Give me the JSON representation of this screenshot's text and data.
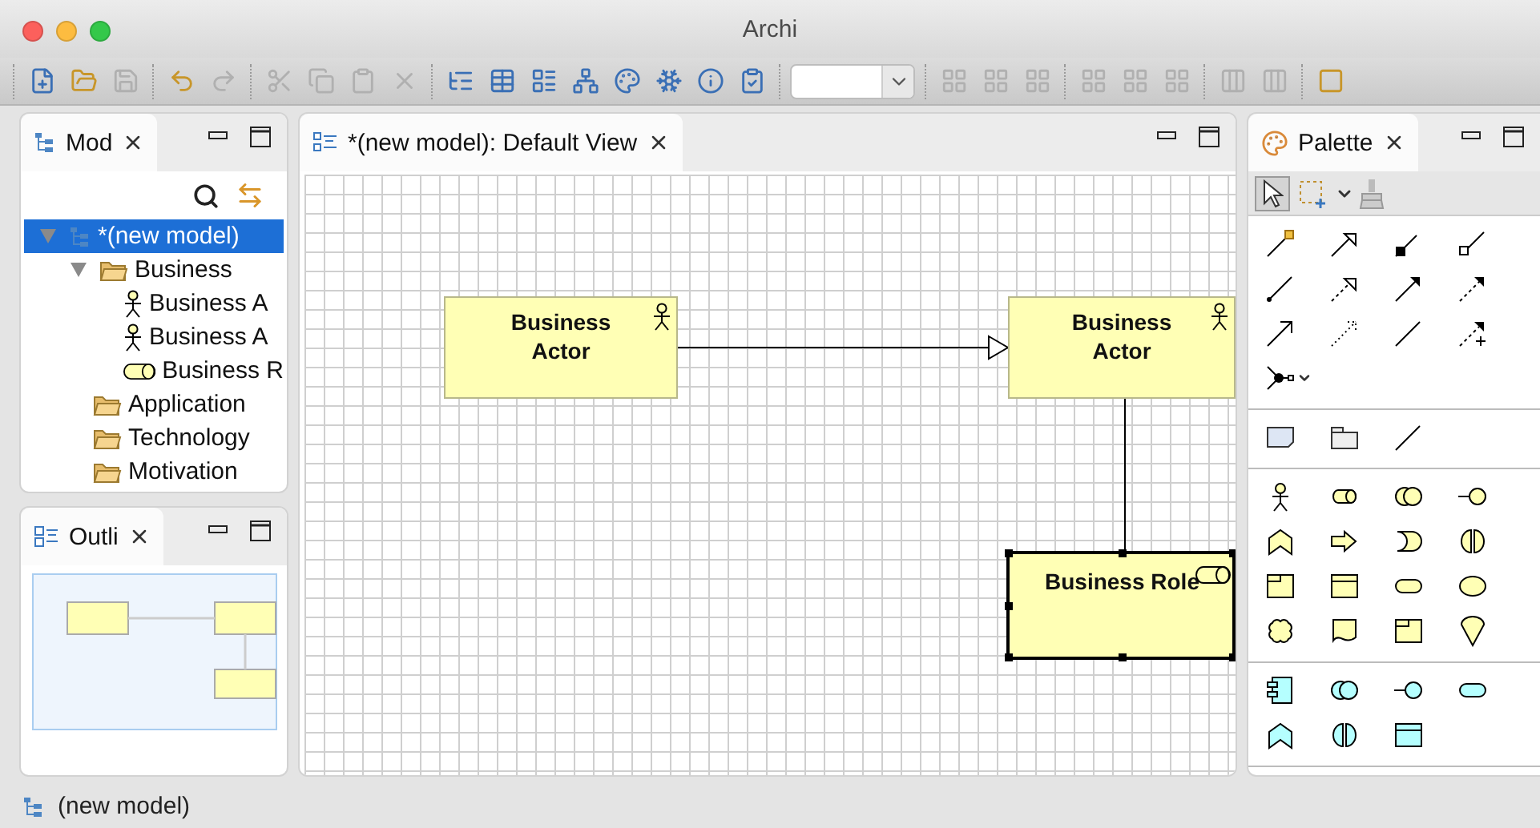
{
  "window": {
    "title": "Archi"
  },
  "toolbar": {
    "groups": [
      {
        "items": [
          {
            "kind": "new",
            "disabled": false
          },
          {
            "kind": "open",
            "disabled": false
          },
          {
            "kind": "save",
            "disabled": true
          }
        ]
      },
      {
        "items": [
          {
            "kind": "undo",
            "disabled": false
          },
          {
            "kind": "redo",
            "disabled": true
          }
        ]
      },
      {
        "items": [
          {
            "kind": "cut",
            "disabled": true
          },
          {
            "kind": "copy",
            "disabled": true
          },
          {
            "kind": "paste",
            "disabled": true
          },
          {
            "kind": "delete",
            "disabled": true
          }
        ]
      },
      {
        "items": [
          {
            "kind": "tree",
            "disabled": false
          },
          {
            "kind": "properties",
            "disabled": false
          },
          {
            "kind": "outline",
            "disabled": false
          },
          {
            "kind": "navigator",
            "disabled": false
          },
          {
            "kind": "palette",
            "disabled": false
          },
          {
            "kind": "hub",
            "disabled": false
          },
          {
            "kind": "info",
            "disabled": false
          },
          {
            "kind": "validate",
            "disabled": false
          }
        ]
      },
      {
        "items": [
          {
            "kind": "combo",
            "disabled": false
          }
        ]
      },
      {
        "items": [
          {
            "kind": "layout",
            "disabled": true
          },
          {
            "kind": "layout",
            "disabled": true
          },
          {
            "kind": "layout",
            "disabled": true
          }
        ]
      },
      {
        "items": [
          {
            "kind": "layout",
            "disabled": true
          },
          {
            "kind": "layout",
            "disabled": true
          },
          {
            "kind": "layout",
            "disabled": true
          }
        ]
      },
      {
        "items": [
          {
            "kind": "size",
            "disabled": true
          },
          {
            "kind": "size",
            "disabled": true
          }
        ]
      },
      {
        "items": [
          {
            "kind": "frame",
            "disabled": false
          }
        ]
      }
    ]
  },
  "model_panel": {
    "tab": "Mod",
    "tree": [
      {
        "label": "*(new model)",
        "kind": "model",
        "selected": true,
        "expanded": true,
        "children": [
          {
            "label": "Business",
            "kind": "folder",
            "selected": false,
            "expanded": true,
            "children": [
              {
                "label": "Business A",
                "kind": "actor",
                "selected": false
              },
              {
                "label": "Business A",
                "kind": "actor",
                "selected": false
              },
              {
                "label": "Business R",
                "kind": "role",
                "selected": false
              }
            ]
          },
          {
            "label": "Application",
            "kind": "folder",
            "selected": false
          },
          {
            "label": "Technology",
            "kind": "folder",
            "selected": false
          },
          {
            "label": "Motivation",
            "kind": "folder",
            "selected": false
          }
        ]
      }
    ]
  },
  "outline_panel": {
    "tab": "Outli"
  },
  "editor": {
    "tab": "*(new model): Default View",
    "nodes": [
      {
        "label": "Business Actor",
        "kind": "actor",
        "selected": false
      },
      {
        "label": "Business Actor",
        "kind": "actor",
        "selected": false
      },
      {
        "label": "Business Role",
        "kind": "role",
        "selected": true
      }
    ],
    "connections": [
      {
        "kind": "specialization"
      },
      {
        "kind": "association"
      }
    ]
  },
  "palette": {
    "title": "Palette",
    "tools": [
      {
        "kind": "select",
        "selected": true
      },
      {
        "kind": "marquee",
        "selected": false
      }
    ]
  },
  "status_bar": {
    "text": "(new model)"
  }
}
